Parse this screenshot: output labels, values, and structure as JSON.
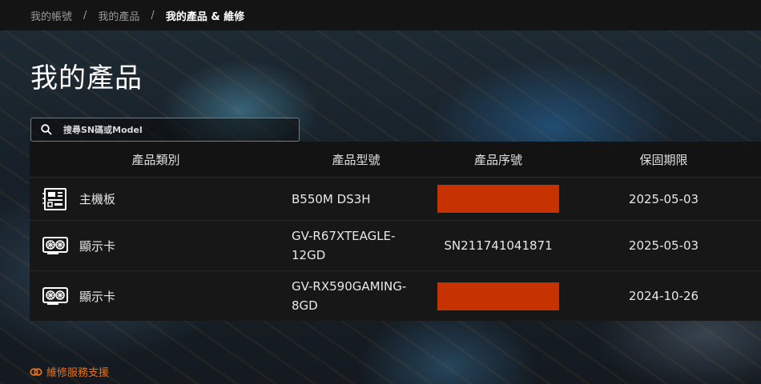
{
  "breadcrumb": {
    "items": [
      "我的帳號",
      "我的產品",
      "我的產品 & 維修"
    ],
    "separator": "/"
  },
  "page": {
    "title": "我的產品"
  },
  "search": {
    "placeholder": "搜尋SN碼或Model",
    "value": ""
  },
  "table": {
    "headers": [
      "產品類別",
      "產品型號",
      "產品序號",
      "保固期限"
    ],
    "rows": [
      {
        "category": "主機板",
        "icon": "motherboard-icon",
        "model_line1": "B550M DS3H",
        "model_line2": "",
        "serial": "",
        "serial_redacted": true,
        "warranty": "2025-05-03"
      },
      {
        "category": "顯示卡",
        "icon": "graphics-card-icon",
        "model_line1": "GV-R67XTEAGLE-",
        "model_line2": "12GD",
        "serial": "SN211741041871",
        "serial_redacted": false,
        "warranty": "2025-05-03"
      },
      {
        "category": "顯示卡",
        "icon": "graphics-card-icon",
        "model_line1": "GV-RX590GAMING-",
        "model_line2": "8GD",
        "serial": "",
        "serial_redacted": true,
        "warranty": "2024-10-26"
      }
    ]
  },
  "footer": {
    "support_link": "維修服務支援",
    "icon": "link-icon"
  },
  "colors": {
    "accent": "#e8711c",
    "redaction": "#c63200",
    "background": "#151515"
  }
}
